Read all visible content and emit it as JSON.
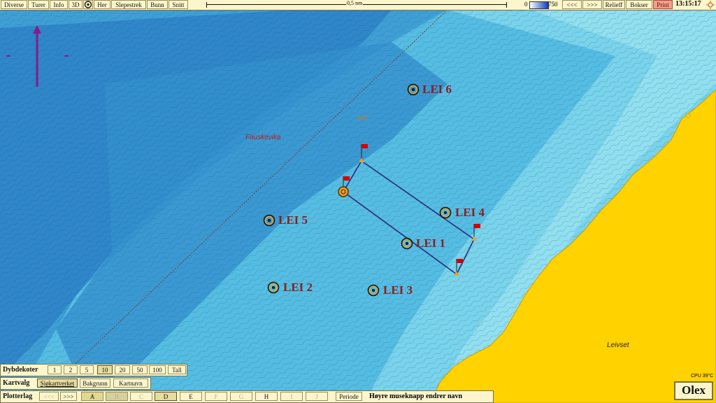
{
  "topbar": {
    "menu": [
      "Diverse",
      "Turer",
      "Info",
      "3D"
    ],
    "menu2": [
      "Her",
      "Slepestrek",
      "Bunn",
      "Snitt"
    ],
    "scale_label": "0,5 nm",
    "depth_min": "0",
    "depth_max": "750",
    "nav_back": "<<<",
    "nav_fwd": ">>>",
    "relief": "Relieff",
    "bokser": "Bokser",
    "print": "Print",
    "clock": "13:15:17"
  },
  "map": {
    "place_fauskevika": "Fauskevika",
    "place_leivset": "Leivset",
    "contour_label": "240",
    "waypoints": [
      {
        "label": "LEI 6"
      },
      {
        "label": "LEI 4"
      },
      {
        "label": "LEI 5"
      },
      {
        "label": "LEI 1"
      },
      {
        "label": "LEI 2"
      },
      {
        "label": "LEI 3"
      }
    ],
    "colors": {
      "land": "#ffd200",
      "route": "#2b2a7a",
      "flag": "#d40000",
      "waypoint": "#8b1e1e",
      "compass": "#8a1a8a"
    }
  },
  "panels": {
    "dybdekoter_label": "Dybdekoter",
    "dybdekoter_values": [
      "1",
      "2",
      "5",
      "10",
      "20",
      "50",
      "100",
      "Tall"
    ],
    "kartvalg_label": "Kartvalg",
    "kartvalg_options": [
      "Sjøkartverket",
      "Bakgrunn",
      "Kartnavn"
    ],
    "plotterlag_label": "Plotterlag",
    "plotter_back": "<<<",
    "plotter_fwd": ">>>",
    "plotter_layers": [
      "A",
      "B",
      "C",
      "D",
      "E",
      "F",
      "G",
      "H",
      "I",
      "J"
    ],
    "periode": "Periode",
    "hint": "Høyre museknapp endrer navn"
  },
  "status": {
    "cpu": "CPU 39°C",
    "brand": "Olex"
  }
}
